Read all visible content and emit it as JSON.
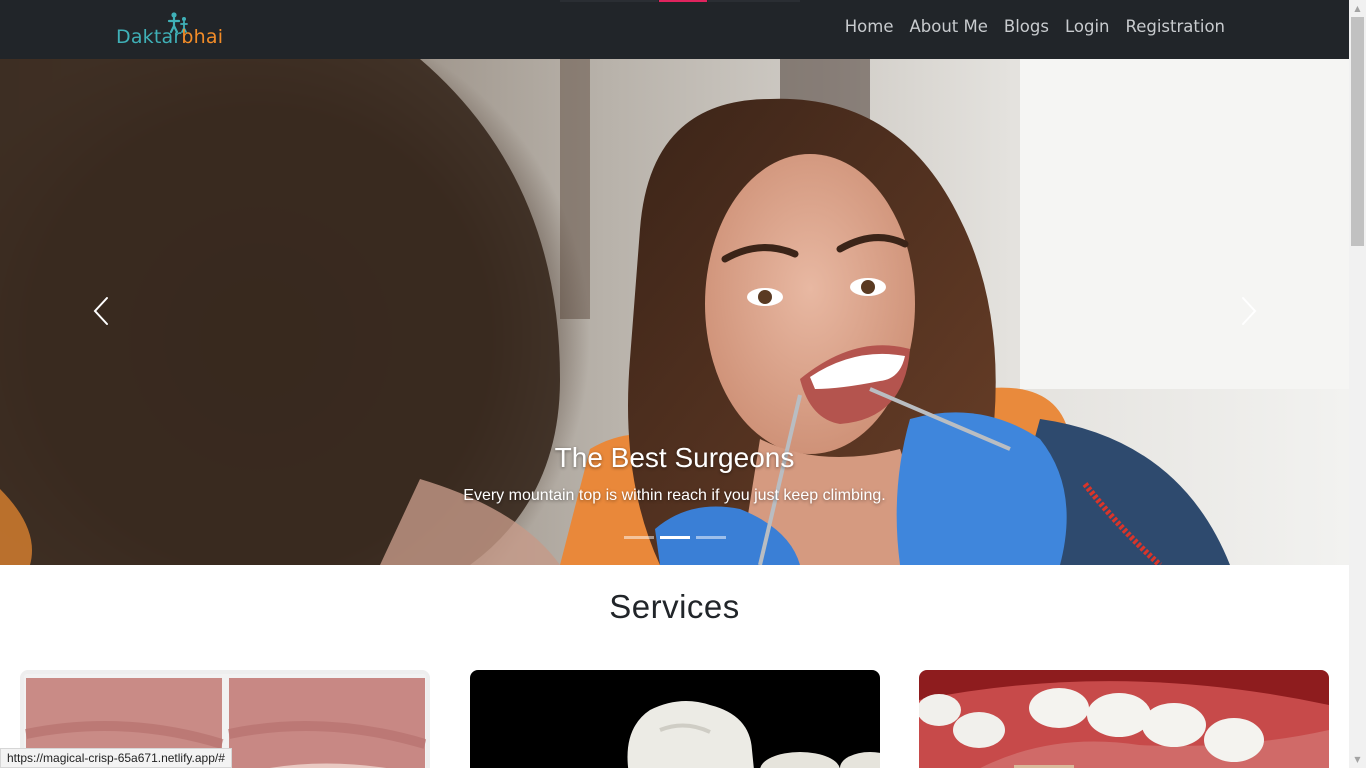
{
  "browser": {
    "status_url": "https://magical-crisp-65a671.netlify.app/#"
  },
  "navbar": {
    "logo_part1": "Daktar",
    "logo_part2": "bhai",
    "links": [
      {
        "label": "Home"
      },
      {
        "label": "About Me"
      },
      {
        "label": "Blogs"
      },
      {
        "label": "Login"
      },
      {
        "label": "Registration"
      }
    ]
  },
  "hero": {
    "title": "The Best Surgeons",
    "subtitle": "Every mountain top is within reach if you just keep climbing.",
    "slide_count": 3,
    "active_slide": 2
  },
  "services": {
    "title": "Services"
  },
  "colors": {
    "navbar_bg": "#212529",
    "logo_teal": "#3fb0b7",
    "logo_orange": "#f28c28",
    "nav_link": "#c8cbce",
    "top_indicator_active": "#e0245e"
  },
  "icons": [
    "chevron-left-icon",
    "chevron-right-icon",
    "logo-figure-icon"
  ]
}
